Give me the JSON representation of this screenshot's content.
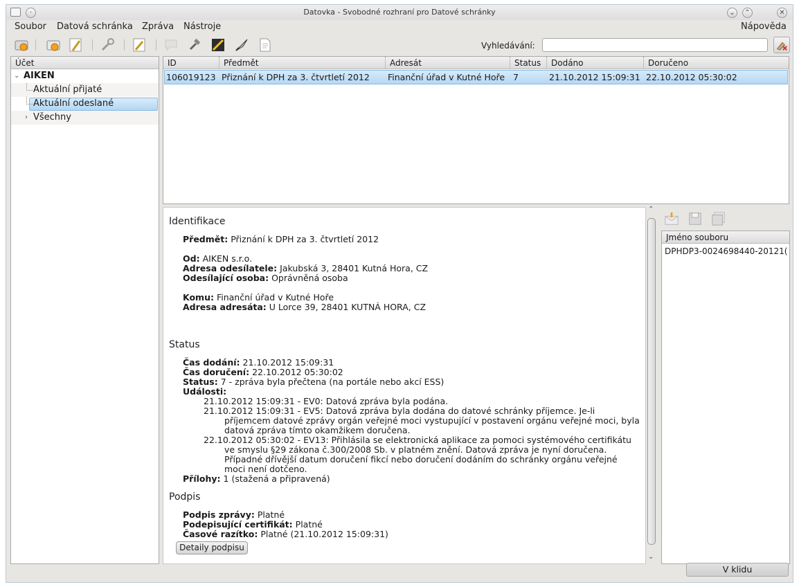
{
  "window": {
    "title": "Datovka - Svobodné rozhraní pro Datové schránky"
  },
  "menu": {
    "items": [
      "Soubor",
      "Datová schránka",
      "Zpráva",
      "Nástroje"
    ],
    "help": "Nápověda"
  },
  "search": {
    "label": "Vyhledávání:",
    "value": ""
  },
  "accounts": {
    "header": "Účet",
    "account_name": "AIKEN",
    "items": [
      "Aktuální přijaté",
      "Aktuální odeslané",
      "Všechny"
    ],
    "selected": "Aktuální odeslané"
  },
  "messages": {
    "columns": [
      "ID",
      "Předmět",
      "Adresát",
      "Status",
      "Dodáno",
      "Doručeno"
    ],
    "rows": [
      {
        "id": "106019123",
        "subject": "Přiznání k DPH za 3. čtvrtletí 2012",
        "recipient": "Finanční úřad v Kutné Hoře",
        "status": "7",
        "delivered": "21.10.2012 15:09:31",
        "accepted": "22.10.2012 05:30:02"
      }
    ]
  },
  "detail": {
    "identification_title": "Identifikace",
    "subject_label": "Předmět:",
    "subject_value": "Přiznání k DPH za 3. čtvrtletí 2012",
    "from_label": "Od:",
    "from_value": "AIKEN s.r.o.",
    "sender_address_label": "Adresa odesílatele:",
    "sender_address_value": "Jakubská 3, 28401 Kutná Hora, CZ",
    "sender_person_label": "Odesílající osoba:",
    "sender_person_value": "Oprávněná osoba",
    "to_label": "Komu:",
    "to_value": "Finanční úřad v Kutné Hoře",
    "recipient_address_label": "Adresa adresáta:",
    "recipient_address_value": "U Lorce 39, 28401 KUTNÁ HORA, CZ",
    "status_title": "Status",
    "delivery_time_label": "Čas dodání:",
    "delivery_time_value": "21.10.2012 15:09:31",
    "acceptance_time_label": "Čas doručení:",
    "acceptance_time_value": "22.10.2012 05:30:02",
    "status_label": "Status:",
    "status_value": "7 - zpráva byla přečtena (na portále nebo akcí ESS)",
    "events_label": "Události:",
    "event_lines": [
      "21.10.2012 15:09:31 - EV0: Datová zpráva byla podána.",
      "21.10.2012 15:09:31 - EV5: Datová zpráva byla dodána do datové schránky příjemce. Je-li",
      "příjemcem datové zprávy orgán veřejné moci vystupující v postavení orgánu veřejné moci, byla",
      "datová zpráva tímto okamžikem doručena.",
      "22.10.2012 05:30:02 - EV13: Přihlásila se elektronická aplikace za pomoci systémového certifikátu",
      "ve smyslu §29 zákona č.300/2008 Sb. v platném znění. Datová zpráva je nyní doručena.",
      "Případné dřívější datum doručení fikcí nebo doručení dodáním do schránky orgánu veřejné",
      "moci není dotčeno."
    ],
    "attachments_label": "Přílohy:",
    "attachments_value": "1 (stažená a připravená)",
    "signature_title": "Podpis",
    "msg_signature_label": "Podpis zprávy:",
    "msg_signature_value": "Platné",
    "cert_label": "Podepisující certifikát:",
    "cert_value": "Platné",
    "timestamp_label": "Časové razítko:",
    "timestamp_value": "Platné (21.10.2012 15:09:31)",
    "details_button": "Detaily podpisu"
  },
  "attachments": {
    "header": "Jméno souboru",
    "files": [
      "DPHDP3-0024698440-20121("
    ]
  },
  "statusbar": {
    "state": "V klidu"
  }
}
